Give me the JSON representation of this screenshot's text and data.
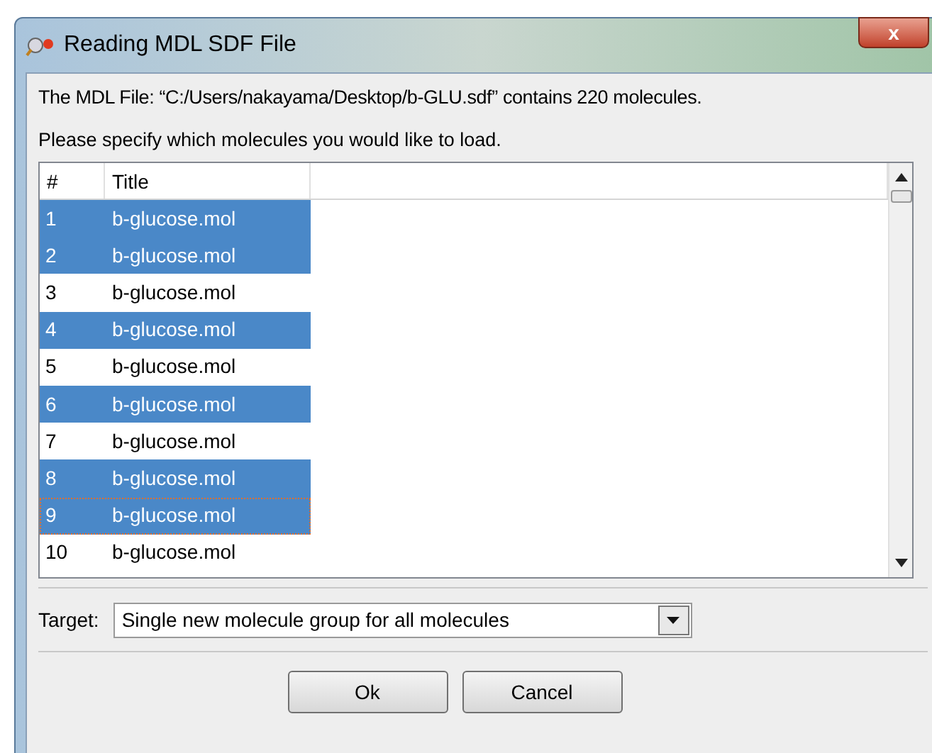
{
  "window": {
    "title": "Reading MDL SDF File",
    "close": "x"
  },
  "info": "The MDL File: “C:/Users/nakayama/Desktop/b-GLU.sdf” contains 220 molecules.",
  "prompt": "Please specify which molecules you would like to load.",
  "table": {
    "columns": [
      "#",
      "Title"
    ],
    "rows": [
      {
        "number": "1",
        "title": "b-glucose.mol",
        "selected": true,
        "focused": false
      },
      {
        "number": "2",
        "title": "b-glucose.mol",
        "selected": true,
        "focused": false
      },
      {
        "number": "3",
        "title": "b-glucose.mol",
        "selected": false,
        "focused": false
      },
      {
        "number": "4",
        "title": "b-glucose.mol",
        "selected": true,
        "focused": false
      },
      {
        "number": "5",
        "title": "b-glucose.mol",
        "selected": false,
        "focused": false
      },
      {
        "number": "6",
        "title": "b-glucose.mol",
        "selected": true,
        "focused": false
      },
      {
        "number": "7",
        "title": "b-glucose.mol",
        "selected": false,
        "focused": false
      },
      {
        "number": "8",
        "title": "b-glucose.mol",
        "selected": true,
        "focused": false
      },
      {
        "number": "9",
        "title": "b-glucose.mol",
        "selected": true,
        "focused": true
      },
      {
        "number": "10",
        "title": "b-glucose.mol",
        "selected": false,
        "focused": false
      }
    ]
  },
  "target": {
    "label": "Target:",
    "value": "Single new molecule group for all molecules"
  },
  "buttons": [
    "Ok",
    "Cancel"
  ]
}
